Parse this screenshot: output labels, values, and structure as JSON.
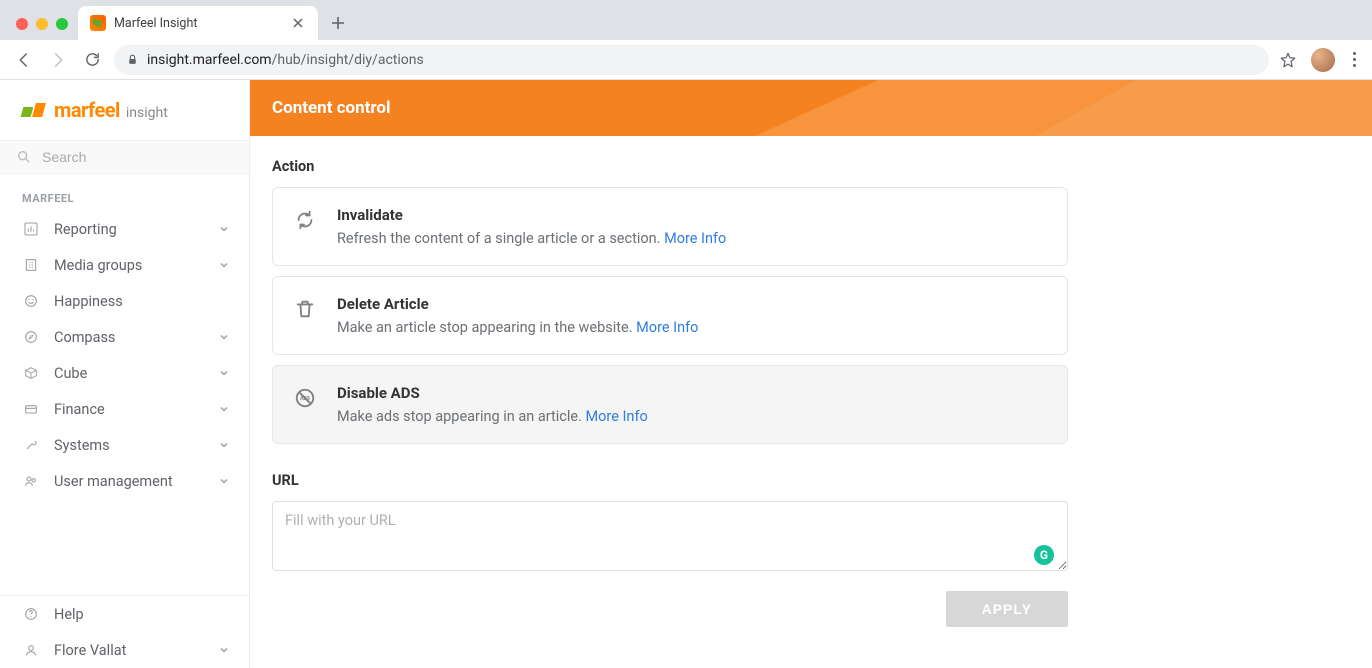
{
  "browser": {
    "tab_title": "Marfeel Insight",
    "url_domain": "insight.marfeel.com",
    "url_path": "/hub/insight/diy/actions"
  },
  "brand": {
    "name": "marfeel",
    "suffix": "insight"
  },
  "search": {
    "placeholder": "Search"
  },
  "sidebar": {
    "section_title": "MARFEEL",
    "items": [
      {
        "label": "Reporting",
        "expandable": true
      },
      {
        "label": "Media groups",
        "expandable": true
      },
      {
        "label": "Happiness",
        "expandable": false
      },
      {
        "label": "Compass",
        "expandable": true
      },
      {
        "label": "Cube",
        "expandable": true
      },
      {
        "label": "Finance",
        "expandable": true
      },
      {
        "label": "Systems",
        "expandable": true
      },
      {
        "label": "User management",
        "expandable": true
      }
    ],
    "bottom": [
      {
        "label": "Help",
        "expandable": false
      },
      {
        "label": "Flore Vallat",
        "expandable": true
      }
    ]
  },
  "hero": {
    "title": "Content control"
  },
  "actions": {
    "section_label": "Action",
    "items": [
      {
        "title": "Invalidate",
        "desc": "Refresh the content of a single article or a section.",
        "more": "More Info",
        "selected": false
      },
      {
        "title": "Delete Article",
        "desc": "Make an article stop appearing in the website.",
        "more": "More Info",
        "selected": false
      },
      {
        "title": "Disable ADS",
        "desc": "Make ads stop appearing in an article.",
        "more": "More Info",
        "selected": true
      }
    ]
  },
  "url_section": {
    "label": "URL",
    "placeholder": "Fill with your URL"
  },
  "apply": {
    "label": "APPLY"
  },
  "grammarly": {
    "label": "G"
  }
}
